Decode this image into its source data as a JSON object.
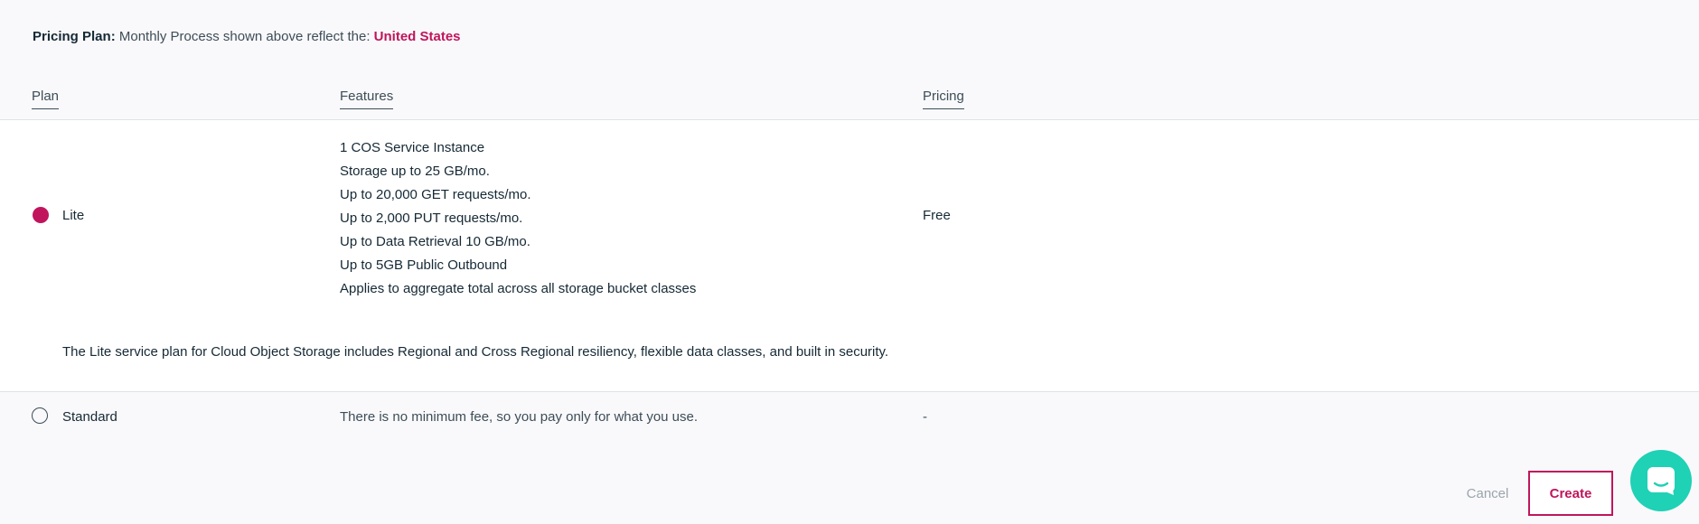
{
  "pricing_plan": {
    "label": "Pricing Plan:",
    "text": "Monthly Process shown above reflect the:",
    "country": "United States"
  },
  "columns": {
    "plan": "Plan",
    "features": "Features",
    "pricing": "Pricing"
  },
  "plans": [
    {
      "name": "Lite",
      "selected": true,
      "features": [
        "1 COS Service Instance",
        "Storage up to 25 GB/mo.",
        "Up to 20,000 GET requests/mo.",
        "Up to 2,000 PUT requests/mo.",
        "Up to Data Retrieval 10 GB/mo.",
        "Up to 5GB Public Outbound",
        "Applies to aggregate total across all storage bucket classes"
      ],
      "price": "Free",
      "description": "The Lite service plan for Cloud Object Storage includes Regional and Cross Regional resiliency, flexible data classes, and built in security."
    },
    {
      "name": "Standard",
      "selected": false,
      "features_text": "There is no minimum fee, so you pay only for what you use.",
      "price": "-"
    }
  ],
  "actions": {
    "cancel": "Cancel",
    "create": "Create"
  },
  "chat": {
    "icon": "chat-bubble-icon"
  },
  "colors": {
    "accent": "#c0155c",
    "chat": "#1fd1b5",
    "text": "#152935",
    "background": "#f9f9fb"
  }
}
